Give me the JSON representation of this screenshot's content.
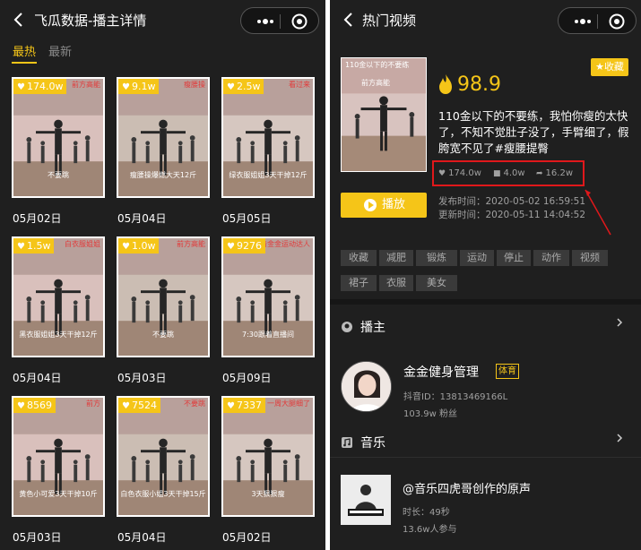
{
  "left": {
    "title": "飞瓜数据-播主详情",
    "tabs": [
      "最热",
      "最新"
    ],
    "videos": [
      {
        "likes": "174.0w",
        "date": "05月02日",
        "caption": [
          "前方高能",
          "不要跳"
        ]
      },
      {
        "likes": "9.1w",
        "date": "05月04日",
        "caption": [
          "瘦腰操",
          "瘦腰操爆燃大天12斤"
        ]
      },
      {
        "likes": "2.5w",
        "date": "05月05日",
        "caption": [
          "看过来",
          "绿衣服姐姐3天干掉12斤"
        ]
      },
      {
        "likes": "1.5w",
        "date": "05月04日",
        "caption": [
          "白衣服姐姐",
          "黑衣服姐姐3天干掉12斤"
        ]
      },
      {
        "likes": "1.0w",
        "date": "05月03日",
        "caption": [
          "前方高能",
          "不要跳"
        ]
      },
      {
        "likes": "9276",
        "date": "05月09日",
        "caption": [
          "关注跟着金金运动达人",
          "7:30跟着直播间"
        ]
      },
      {
        "likes": "8569",
        "date": "05月03日",
        "caption": [
          "前方",
          "黄色小可爱3天干掉10斤"
        ]
      },
      {
        "likes": "7524",
        "date": "05月04日",
        "caption": [
          "不要跳",
          "白色衣服小姐3天干掉15斤"
        ]
      },
      {
        "likes": "7337",
        "date": "05月02日",
        "caption": [
          "一周大腿细了",
          "3天狠狠瘦"
        ]
      }
    ]
  },
  "right": {
    "title": "热门视频",
    "cover_caption": [
      "110金以下的不要练",
      "前方高能"
    ],
    "score": "98.9",
    "fav_label": "收藏",
    "description": "110金以下的不要练，我怕你瘦的太快了，不知不觉肚子没了，手臂细了，假胯宽不见了#瘦腰提臀",
    "stats": {
      "likes": "174.0w",
      "comments": "4.0w",
      "shares": "16.2w"
    },
    "play_label": "播放",
    "publish_time": "发布时间：2020-05-02 16:59:51",
    "update_time": "更新时间：2020-05-11 14:04:52",
    "tags": [
      "收藏",
      "减肥",
      "锻炼",
      "运动",
      "停止",
      "动作",
      "视频",
      "裙子",
      "衣服",
      "美女"
    ],
    "host_section": "播主",
    "host": {
      "name": "金金健身管理",
      "category": "体育",
      "douyin_id": "抖音ID：13813469166L",
      "fans": "103.9w 粉丝"
    },
    "music_section": "音乐",
    "music": {
      "title": "@音乐四虎哥创作的原声",
      "duration": "时长：49秒",
      "participants": "13.6w人参与"
    }
  },
  "colors": {
    "accent": "#f5c518",
    "background": "#1f1f1f",
    "highlight": "#e0181b"
  }
}
